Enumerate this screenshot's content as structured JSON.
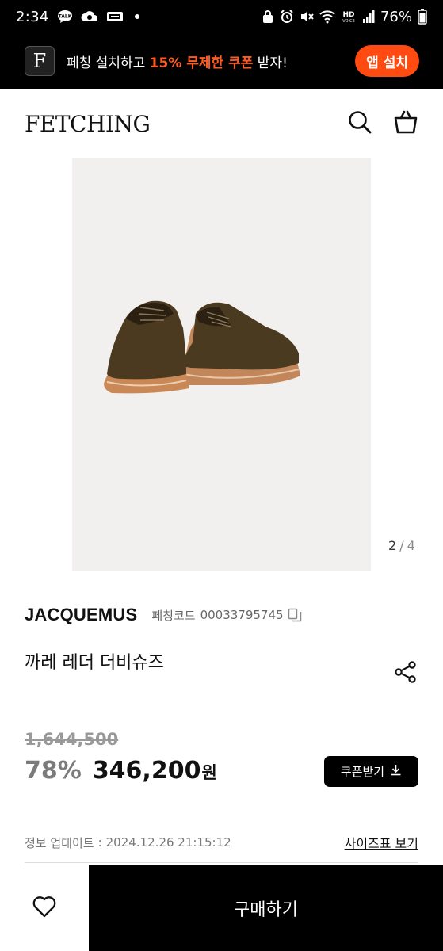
{
  "status_bar": {
    "time": "2:34",
    "notification_icons": [
      "talk-icon",
      "cloud-icon",
      "tv-icon"
    ],
    "battery_text": "76%",
    "network_label_top": "HD",
    "network_label_bottom": "VOICE"
  },
  "promo": {
    "logo_letter": "F",
    "text_before": "페칭 설치하고 ",
    "text_highlight": "15% 무제한 쿠폰",
    "text_after": " 받자!",
    "install_label": "앱 설치",
    "highlight_color": "#ff5a1f",
    "button_color": "#ff4a12"
  },
  "header": {
    "logo": "FETCHING",
    "icons": [
      "search-icon",
      "shopping-bag-icon"
    ]
  },
  "gallery": {
    "current": "2",
    "separator": "/",
    "total": "4"
  },
  "product": {
    "brand": "JACQUEMUS",
    "code_label": "페칭코드",
    "code_value": "00033795745",
    "name": "까레 레더 더비슈즈",
    "original_price": "1,644,500",
    "discount": "78%",
    "sale_price": "346,200",
    "currency": "원",
    "coupon_label": "쿠폰받기",
    "update_label": "정보 업데이트",
    "update_sep": ":",
    "update_date": "2024.12.26 21:15:12",
    "size_chart_label": "사이즈표 보기"
  },
  "bottom_bar": {
    "buy_label": "구매하기"
  }
}
